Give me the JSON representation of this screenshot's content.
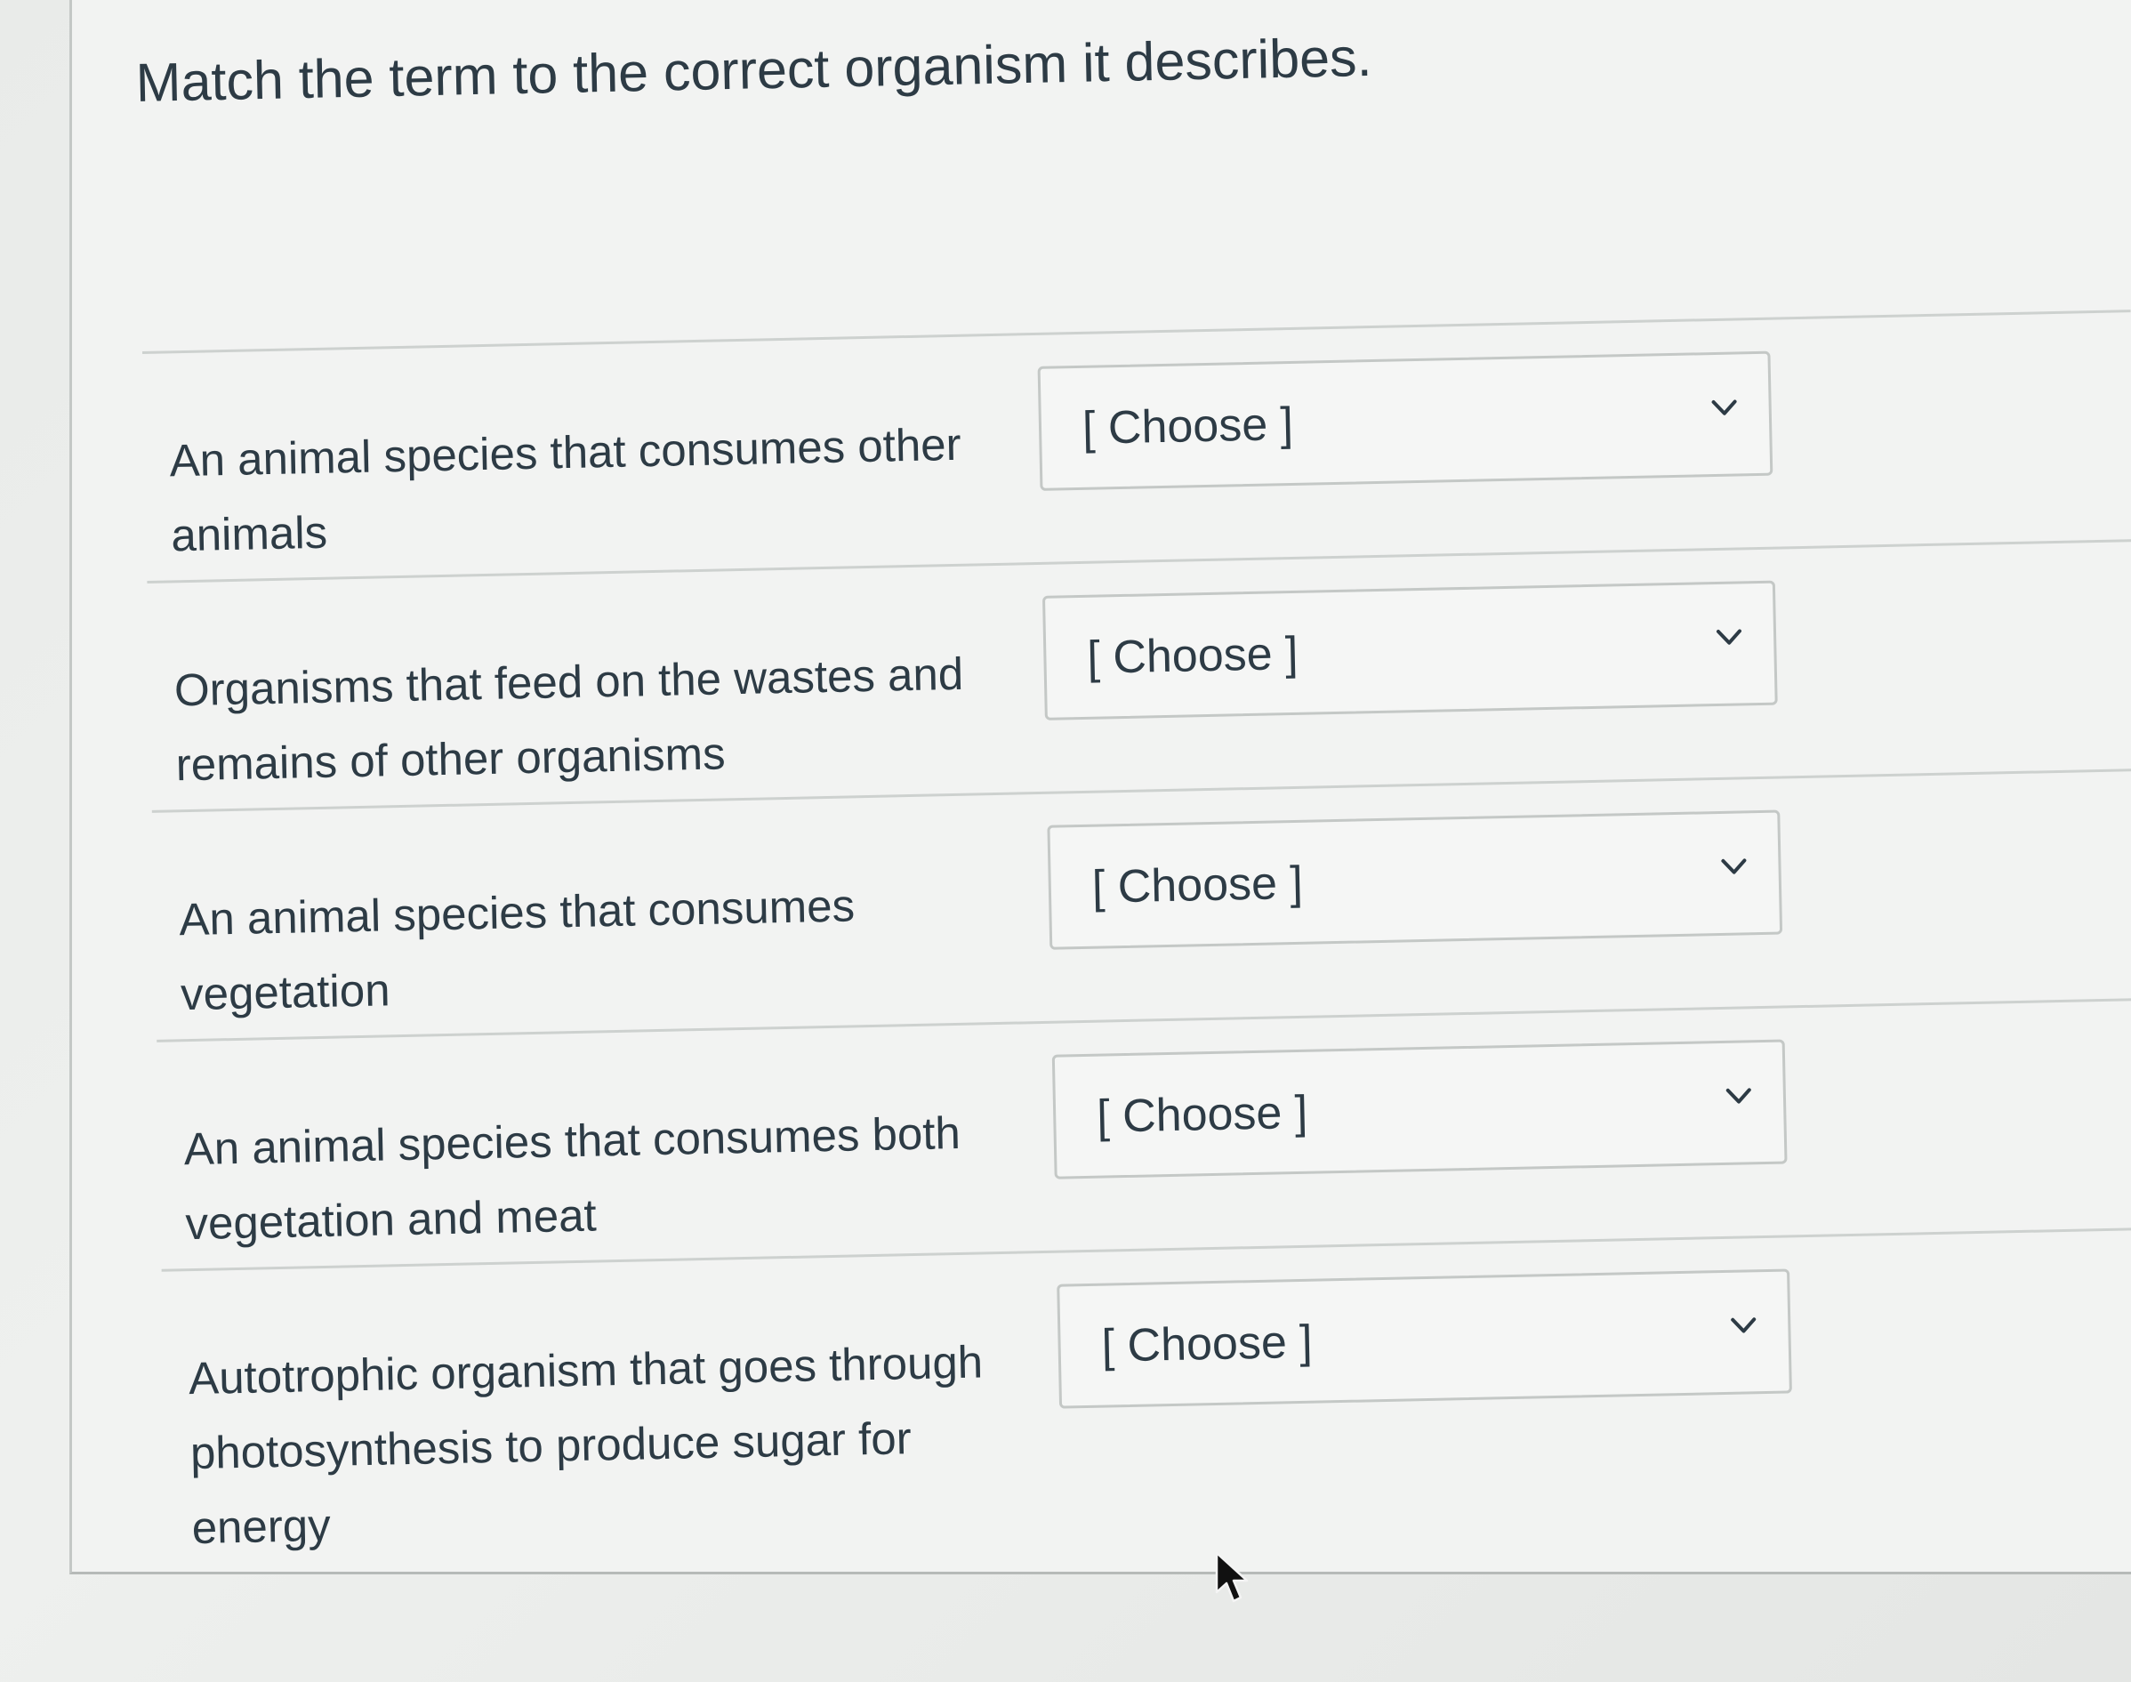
{
  "question": {
    "prompt": "Match the term to the correct organism it describes."
  },
  "matches": [
    {
      "term_line1": "An animal species that consumes other",
      "term_line2": "animals",
      "selected": "[ Choose ]"
    },
    {
      "term_line1": "Organisms that feed on the wastes and",
      "term_line2": "remains of other organisms",
      "selected": "[ Choose ]"
    },
    {
      "term_line1": "An animal species that consumes",
      "term_line2": "vegetation",
      "selected": "[ Choose ]"
    },
    {
      "term_line1": "An animal species that consumes both",
      "term_line2": "vegetation and meat",
      "selected": "[ Choose ]"
    },
    {
      "term_line1": "Autotrophic organism that goes through",
      "term_line2": "photosynthesis to produce sugar for energy",
      "selected": "[ Choose ]"
    }
  ],
  "icons": {
    "dropdown": "chevron-down-icon",
    "pointer": "mouse-cursor-icon"
  },
  "colors": {
    "text": "#2d3b45",
    "border": "#c4c8c6",
    "background": "#f2f3f2"
  }
}
